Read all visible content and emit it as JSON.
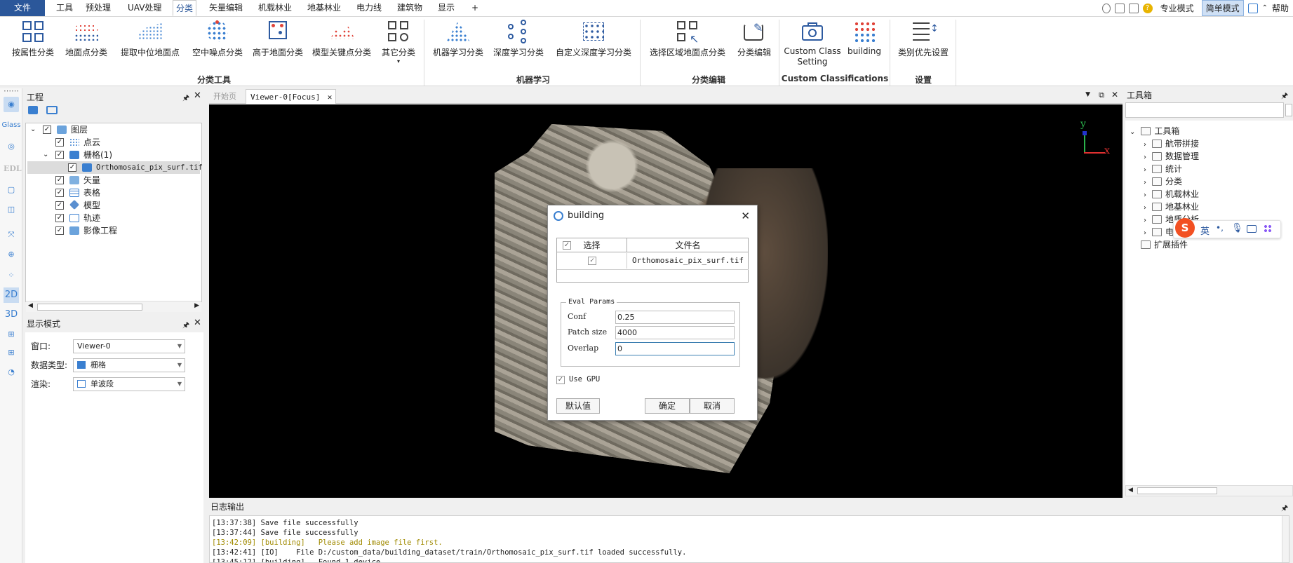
{
  "menubar": {
    "items": [
      "文件",
      "工具",
      "预处理",
      "UAV处理",
      "分类",
      "矢量编辑",
      "机载林业",
      "地基林业",
      "电力线",
      "建筑物",
      "显示",
      "+"
    ],
    "active": "分类",
    "right": {
      "expert_mode": "专业模式",
      "simple_mode": "简单模式",
      "help": "帮助"
    }
  },
  "ribbon": {
    "buttons": [
      "按属性分类",
      "地面点分类",
      "提取中位地面点",
      "空中噪点分类",
      "高于地面分类",
      "模型关键点分类",
      "其它分类",
      "机器学习分类",
      "深度学习分类",
      "自定义深度学习分类",
      "选择区域地面点分类",
      "分类编辑",
      "Custom Class",
      "Setting",
      "building",
      "类别优先设置"
    ],
    "groups": [
      "分类工具",
      "机器学习",
      "分类编辑",
      "Custom Classifications",
      "设置"
    ]
  },
  "left_strip": {
    "glass": "Glass",
    "edl": "EDL",
    "two_d": "2D",
    "three_d": "3D"
  },
  "project": {
    "title": "工程",
    "tree": [
      "图层",
      "点云",
      "栅格(1)",
      "Orthomosaic_pix_surf.tif",
      "矢量",
      "表格",
      "模型",
      "轨迹",
      "影像工程"
    ]
  },
  "display_mode": {
    "title": "显示模式",
    "window_label": "窗口:",
    "window_value": "Viewer-0",
    "datatype_label": "数据类型:",
    "datatype_value": "栅格",
    "render_label": "渲染:",
    "render_value": "单波段"
  },
  "viewer": {
    "tabs": [
      "开始页",
      "Viewer-0[Focus]"
    ],
    "axis_y": "y",
    "axis_x": "x"
  },
  "dialog": {
    "title": "building",
    "col_select": "选择",
    "col_filename": "文件名",
    "filename": "Orthomosaic_pix_surf.tif",
    "group": "Eval Params",
    "conf_label": "Conf",
    "conf_value": "0.25",
    "patch_label": "Patch size",
    "patch_value": "4000",
    "overlap_label": "Overlap",
    "overlap_value": "0",
    "gpu_label": "Use GPU",
    "default_btn": "默认值",
    "ok_btn": "确定",
    "cancel_btn": "取消"
  },
  "toolbox": {
    "title": "工具箱",
    "root": "工具箱",
    "items": [
      "航带拼接",
      "数据管理",
      "统计",
      "分类",
      "机载林业",
      "地基林业",
      "地质分析",
      "电"
    ],
    "plugins": "扩展插件"
  },
  "ime": {
    "en": "英"
  },
  "log": {
    "title": "日志输出",
    "lines": [
      "[13:37:38] Save file successfully",
      "[13:37:44] Save file successfully",
      "[13:42:09] [building]   Please add image file first.",
      "[13:42:41] [IO]    File D:/custom_data/building_dataset/train/Orthomosaic_pix_surf.tif loaded successfully.",
      "[13:45:12] [building]   Found 1 device"
    ],
    "warn_color": "#a08a00"
  }
}
